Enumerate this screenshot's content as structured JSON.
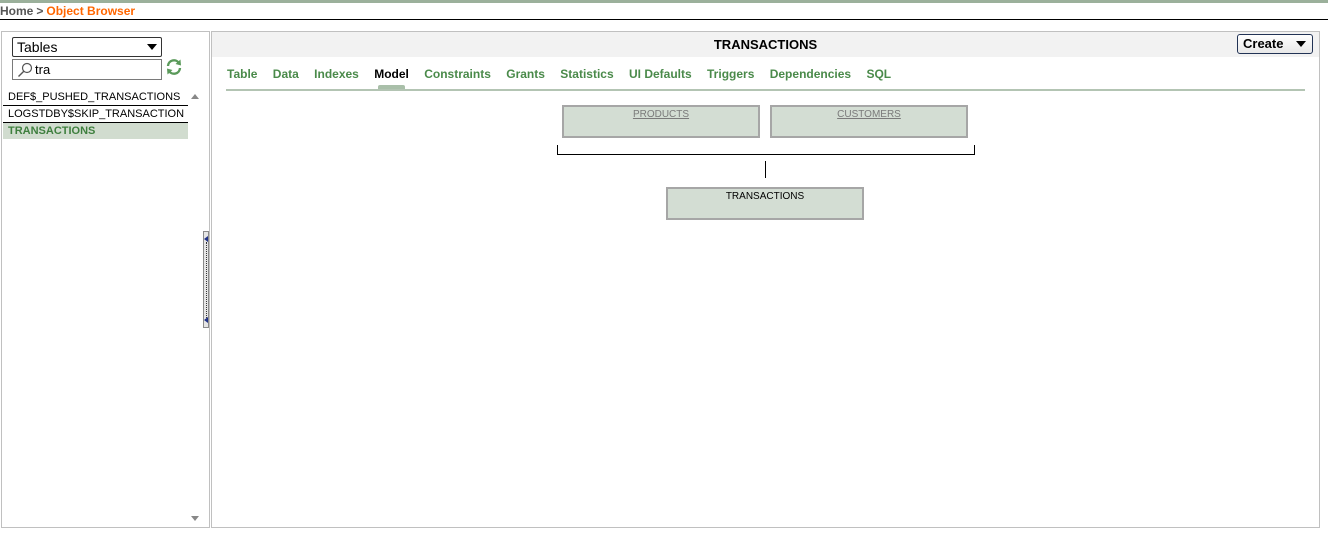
{
  "breadcrumb": {
    "home": "Home",
    "separator": ">",
    "current": "Object Browser"
  },
  "sidebar": {
    "object_type": "Tables",
    "search_value": "tra",
    "items": [
      {
        "label": "DEF$_PUSHED_TRANSACTIONS",
        "selected": false
      },
      {
        "label": "LOGSTDBY$SKIP_TRANSACTION",
        "selected": false
      },
      {
        "label": "TRANSACTIONS",
        "selected": true
      }
    ]
  },
  "main": {
    "title": "TRANSACTIONS",
    "create_label": "Create",
    "tabs": [
      {
        "label": "Table",
        "active": false
      },
      {
        "label": "Data",
        "active": false
      },
      {
        "label": "Indexes",
        "active": false
      },
      {
        "label": "Model",
        "active": true
      },
      {
        "label": "Constraints",
        "active": false
      },
      {
        "label": "Grants",
        "active": false
      },
      {
        "label": "Statistics",
        "active": false
      },
      {
        "label": "UI Defaults",
        "active": false
      },
      {
        "label": "Triggers",
        "active": false
      },
      {
        "label": "Dependencies",
        "active": false
      },
      {
        "label": "SQL",
        "active": false
      }
    ],
    "model": {
      "parents": [
        "PRODUCTS",
        "CUSTOMERS"
      ],
      "current": "TRANSACTIONS"
    }
  },
  "colors": {
    "accent_orange": "#ff6600",
    "tab_green": "#4a8a4a",
    "selected_bg": "#d1dccf",
    "model_box_bg": "#d3ddd3"
  },
  "icons": {
    "search": "magnifier-icon",
    "refresh": "refresh-icon",
    "dropdown": "chevron-down-icon"
  }
}
